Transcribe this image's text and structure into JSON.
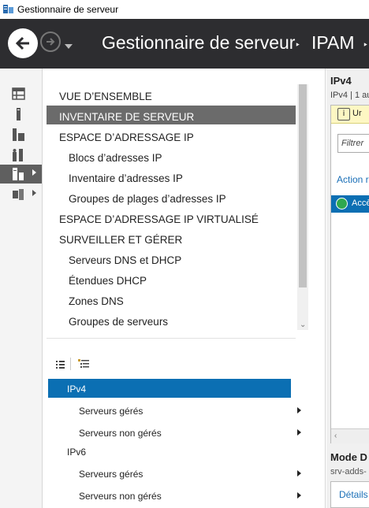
{
  "window": {
    "title": "Gestionnaire de serveur"
  },
  "header": {
    "breadcrumb": [
      "Gestionnaire de serveur",
      "IPAM"
    ],
    "separator": "‣"
  },
  "rail": {
    "items": [
      {
        "icon": "dashboard-icon"
      },
      {
        "icon": "local-server-icon"
      },
      {
        "icon": "all-servers-icon"
      },
      {
        "icon": "file-services-icon"
      },
      {
        "icon": "ipam-icon",
        "active": true
      },
      {
        "icon": "roles-group-icon"
      }
    ]
  },
  "nav": {
    "items": [
      {
        "label": "VUE D’ENSEMBLE"
      },
      {
        "label": "INVENTAIRE DE SERVEUR",
        "selected": true
      },
      {
        "label": "ESPACE D’ADRESSAGE IP"
      },
      {
        "label": "Blocs d’adresses IP",
        "sub": true
      },
      {
        "label": "Inventaire d’adresses IP",
        "sub": true
      },
      {
        "label": "Groupes de plages d’adresses IP",
        "sub": true
      },
      {
        "label": "ESPACE D’ADRESSAGE IP VIRTUALISÉ"
      },
      {
        "label": "SURVEILLER ET GÉRER"
      },
      {
        "label": "Serveurs DNS et DHCP",
        "sub": true
      },
      {
        "label": "Étendues DHCP",
        "sub": true
      },
      {
        "label": "Zones DNS",
        "sub": true
      },
      {
        "label": "Groupes de serveurs",
        "sub": true
      }
    ]
  },
  "lower_list": {
    "items": [
      {
        "label": "IPv4",
        "indent": false,
        "active": true
      },
      {
        "label": "Serveurs gérés",
        "indent": true
      },
      {
        "label": "Serveurs non gérés",
        "indent": true
      },
      {
        "label": "IPv6",
        "indent": false
      },
      {
        "label": "Serveurs gérés",
        "indent": true
      },
      {
        "label": "Serveurs non gérés",
        "indent": true
      }
    ]
  },
  "content": {
    "title": "IPv4",
    "subtitle": "IPv4 | 1 au",
    "info_text": "Ur",
    "filter_placeholder": "Filtrer",
    "action_link": "Action r",
    "access_row": "Accè",
    "mode_title": "Mode D",
    "mode_sub": "srv-adds-",
    "details_tab": "Détails"
  },
  "colors": {
    "header_bg": "#2d2d30",
    "selection_blue": "#0b6fb3",
    "nav_selected_bg": "#6b6b6b"
  }
}
